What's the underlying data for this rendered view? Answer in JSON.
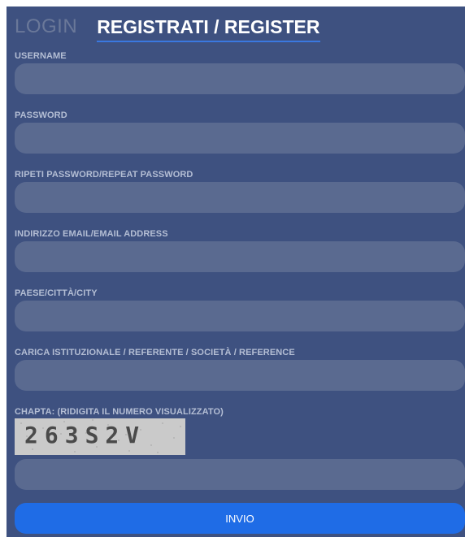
{
  "tabs": {
    "login": "LOGIN",
    "register": "REGISTRATI / REGISTER",
    "active": "register"
  },
  "form": {
    "fields": [
      {
        "label": "USERNAME",
        "value": "",
        "placeholder": ""
      },
      {
        "label": "PASSWORD",
        "value": "",
        "placeholder": ""
      },
      {
        "label": "RIPETI PASSWORD/REPEAT PASSWORD",
        "value": "",
        "placeholder": ""
      },
      {
        "label": "INDIRIZZO EMAIL/EMAIL ADDRESS",
        "value": "",
        "placeholder": ""
      },
      {
        "label": "PAESE/CITTÀ/CITY",
        "value": "",
        "placeholder": ""
      },
      {
        "label": "CARICA ISTITUZIONALE / REFERENTE / SOCIETÀ / REFERENCE",
        "value": "",
        "placeholder": ""
      }
    ],
    "captcha": {
      "label": "CHAPTA: (RIDIGITA IL NUMERO VISUALIZZATO)",
      "image_text": "263S2V",
      "value": "",
      "placeholder": ""
    },
    "submit_label": "INVIO"
  },
  "colors": {
    "panel_bg": "#3e5180",
    "input_bg": "#5a6a90",
    "label": "#b4bed4",
    "tab_inactive": "#6a7899",
    "tab_active": "#ffffff",
    "tab_underline": "#3a78e0",
    "button_bg": "#1f6ce6"
  }
}
